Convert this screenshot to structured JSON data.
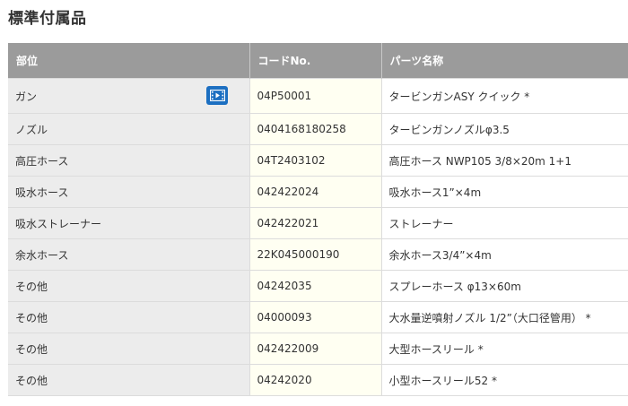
{
  "title": "標準付属品",
  "table": {
    "headers": [
      "部位",
      "コードNo.",
      "パーツ名称"
    ],
    "rows": [
      {
        "part": "ガン",
        "code": "04P50001",
        "name": "タービンガンASY クイック *"
      },
      {
        "part": "ノズル",
        "code": "0404168180258",
        "name": "タービンガンノズルφ3.5"
      },
      {
        "part": "高圧ホース",
        "code": "04T2403102",
        "name": "高圧ホース NWP105 3/8×20m 1+1"
      },
      {
        "part": "吸水ホース",
        "code": "042422024",
        "name": "吸水ホース1”×4m"
      },
      {
        "part": "吸水ストレーナー",
        "code": "042422021",
        "name": "ストレーナー"
      },
      {
        "part": "余水ホース",
        "code": "22K045000190",
        "name": "余水ホース3/4”×4m"
      },
      {
        "part": "その他",
        "code": "04242035",
        "name": "スプレーホース φ13×60m"
      },
      {
        "part": "その他",
        "code": "04000093",
        "name": "大水量逆噴射ノズル 1/2”（大口径管用） *"
      },
      {
        "part": "その他",
        "code": "042422009",
        "name": "大型ホースリール *"
      },
      {
        "part": "その他",
        "code": "04242020",
        "name": "小型ホースリール52 *"
      }
    ]
  },
  "video_icon": "film-video-icon",
  "colors": {
    "header_bg": "#9b9b9b",
    "part_bg": "#ececec",
    "code_bg": "#fffff2",
    "video_button": "#1c6fc1"
  }
}
